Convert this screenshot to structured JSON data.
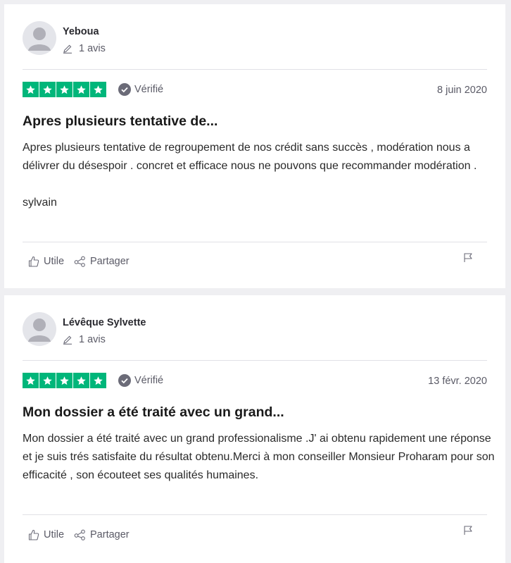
{
  "reviews": [
    {
      "reviewer_name": "Yeboua",
      "review_count": "1 avis",
      "rating": 5,
      "verified_label": "Vérifié",
      "date": "8 juin 2020",
      "title": "Apres plusieurs tentative de...",
      "body": "Apres plusieurs tentative de regroupement de nos crédit sans succès , modération nous a délivrer du désespoir . concret et efficace nous ne pouvons que recommander modération .",
      "signature": "sylvain",
      "useful_label": "Utile",
      "share_label": "Partager"
    },
    {
      "reviewer_name": "Lévêque Sylvette",
      "review_count": "1 avis",
      "rating": 5,
      "verified_label": "Vérifié",
      "date": "13 févr. 2020",
      "title": "Mon dossier a été traité avec un grand...",
      "body": "Mon dossier a été traité avec un grand professionalisme .J' ai obtenu rapidement une réponse et je suis trés satisfaite du résultat obtenu.Merci à mon conseiller Monsieur Proharam pour son efficacité , son écouteet ses qualités humaines.",
      "useful_label": "Utile",
      "share_label": "Partager"
    }
  ],
  "colors": {
    "star_green": "#00b67a",
    "page_bg": "#efeff2",
    "muted_text": "#5a5a66"
  },
  "icons": {
    "avatar": "avatar-placeholder-icon",
    "review_count": "pencil-icon",
    "verified": "check-circle-icon",
    "useful": "thumbs-up-icon",
    "share": "share-icon",
    "report": "flag-icon"
  }
}
